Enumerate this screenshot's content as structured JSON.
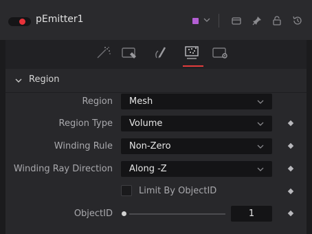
{
  "node": {
    "title": "pEmitter1",
    "enabled": true,
    "color": "#b45fd4"
  },
  "header_icons": [
    "color-swatch-dropdown",
    "window-icon",
    "pin-icon",
    "lock-icon",
    "reset-icon"
  ],
  "tabs": [
    {
      "name": "controls-tab",
      "icon": "sparkle-icon"
    },
    {
      "name": "set-tab",
      "icon": "tag-icon"
    },
    {
      "name": "style-tab",
      "icon": "brush-icon"
    },
    {
      "name": "region-tab",
      "icon": "region-icon",
      "active": true
    },
    {
      "name": "settings-tab",
      "icon": "gear-icon"
    }
  ],
  "section": {
    "title": "Region",
    "expanded": true
  },
  "fields": {
    "region": {
      "label": "Region",
      "value": "Mesh"
    },
    "region_type": {
      "label": "Region Type",
      "value": "Volume"
    },
    "winding_rule": {
      "label": "Winding Rule",
      "value": "Non-Zero"
    },
    "winding_ray_direction": {
      "label": "Winding Ray Direction",
      "value": "Along -Z"
    },
    "limit_by_objectid": {
      "label": "Limit By ObjectID",
      "checked": false
    },
    "objectid": {
      "label": "ObjectID",
      "value": "1",
      "slider_fraction": 0
    }
  },
  "accent_color": "#e43c3c"
}
